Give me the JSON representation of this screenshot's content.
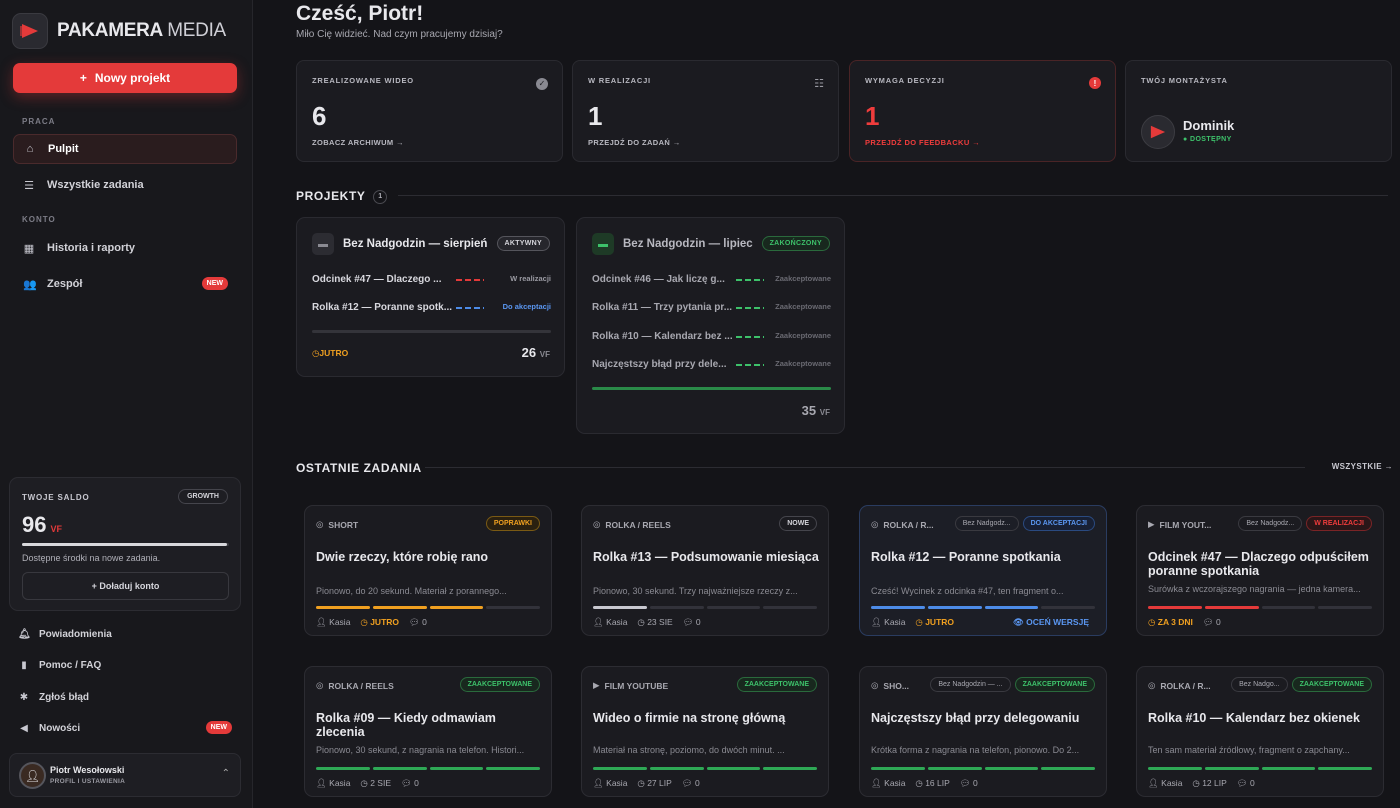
{
  "brand": {
    "name_a": "PAKAMERA",
    "name_b": "MEDIA"
  },
  "sidebar": {
    "new_project": "Nowy projekt",
    "section_work": "PRACA",
    "section_account": "KONTO",
    "items": [
      {
        "label": "Pulpit",
        "icon": "home-icon"
      },
      {
        "label": "Wszystkie zadania",
        "icon": "list-icon"
      },
      {
        "label": "Historia i raporty",
        "icon": "calendar-icon"
      },
      {
        "label": "Zespół",
        "icon": "users-icon",
        "badge": "NEW"
      }
    ],
    "balance": {
      "title": "TWOJE SALDO",
      "plan": "GROWTH",
      "value": "96",
      "unit": "VF",
      "desc": "Dostępne środki na nowe zadania.",
      "topup": "+ Doładuj konto",
      "fill": 0.99
    },
    "bottom": [
      {
        "label": "Powiadomienia",
        "icon": "bell-icon"
      },
      {
        "label": "Pomoc / FAQ",
        "icon": "book-icon"
      },
      {
        "label": "Zgłoś błąd",
        "icon": "bug-icon"
      },
      {
        "label": "Nowości",
        "icon": "megaphone-icon",
        "badge": "NEW"
      }
    ],
    "user": {
      "name": "Piotr Wesołowski",
      "sub": "PROFIL I USTAWIENIA"
    }
  },
  "header": {
    "title": "Cześć, Piotr!",
    "subtitle": "Miło Cię widzieć. Nad czym pracujemy dzisiaj?"
  },
  "stats": [
    {
      "title": "ZREALIZOWANE WIDEO",
      "value": "6",
      "link": "ZOBACZ ARCHIWUM →"
    },
    {
      "title": "W REALIZACJI",
      "value": "1",
      "link": "PRZEJDŹ DO ZADAŃ →"
    },
    {
      "title": "WYMAGA DECYZJI",
      "value": "1",
      "link": "PRZEJDŹ DO FEEDBACKU →",
      "alert": "!"
    },
    {
      "title": "TWÓJ MONTAŻYSTA",
      "name": "Dominik",
      "status": "DOSTĘPNY"
    }
  ],
  "projects_section": {
    "title": "PROJEKTY",
    "count": "1"
  },
  "projects": [
    {
      "title": "Bez Nadgodzin — sierpień",
      "badge": "AKTYWNY",
      "rows": [
        {
          "name": "Odcinek #47 — Dlaczego ...",
          "status": "W realizacji"
        },
        {
          "name": "Rolka #12 — Poranne spotk...",
          "status": "Do akceptacji"
        }
      ],
      "deadline": "JUTRO",
      "vf": "26",
      "unit": "VF"
    },
    {
      "title": "Bez Nadgodzin — lipiec",
      "badge": "ZAKOŃCZONY",
      "rows": [
        {
          "name": "Odcinek #46 — Jak liczę g...",
          "status": "Zaakceptowane"
        },
        {
          "name": "Rolka #11 — Trzy pytania pr...",
          "status": "Zaakceptowane"
        },
        {
          "name": "Rolka #10 — Kalendarz bez ...",
          "status": "Zaakceptowane"
        },
        {
          "name": "Najczęstszy błąd przy dele...",
          "status": "Zaakceptowane"
        }
      ],
      "vf": "35",
      "unit": "VF"
    }
  ],
  "tasks_section": {
    "title": "OSTATNIE ZADANIA",
    "all": "WSZYSTKIE →"
  },
  "tasks": [
    {
      "cat": "SHORT",
      "tag": "POPRAWKI",
      "title": "Dwie rzeczy, które robię rano",
      "desc": "Pionowo, do 20 sekund. Materiał z porannego...",
      "user": "Kasia",
      "date": "JUTRO",
      "comments": "0"
    },
    {
      "cat": "ROLKA / REELS",
      "tag": "NOWE",
      "title": "Rolka #13 — Podsumowanie miesiąca",
      "desc": "Pionowo, 30 sekund. Trzy najważniejsze rzeczy z...",
      "user": "Kasia",
      "date": "23 SIE",
      "comments": "0"
    },
    {
      "cat": "ROLKA / R...",
      "proj": "Bez Nadgodz...",
      "tag": "DO AKCEPTACJI",
      "title": "Rolka #12 — Poranne spotkania",
      "desc": "Cześć! Wycinek z odcinka #47, ten fragment o...",
      "user": "Kasia",
      "date": "JUTRO",
      "comments": "",
      "action": "OCEŃ WERSJĘ"
    },
    {
      "cat": "FILM YOUT...",
      "proj": "Bez Nadgodz...",
      "tag": "W REALIZACJI",
      "title": "Odcinek #47 — Dlaczego odpuściłem poranne spotkania",
      "desc": "Surówka z wczorajszego nagrania — jedna kamera...",
      "user": "",
      "date": "ZA 3 DNI",
      "comments": "0"
    },
    {
      "cat": "ROLKA / REELS",
      "tag": "ZAAKCEPTOWANE",
      "title": "Rolka #09 — Kiedy odmawiam zlecenia",
      "desc": "Pionowo, 30 sekund, z nagrania na telefon. Histori...",
      "user": "Kasia",
      "date": "2 SIE",
      "comments": "0"
    },
    {
      "cat": "FILM YOUTUBE",
      "tag": "ZAAKCEPTOWANE",
      "title": "Wideo o firmie na stronę główną",
      "desc": "Materiał na stronę, poziomo, do dwóch minut. ...",
      "user": "Kasia",
      "date": "27 LIP",
      "comments": "0"
    },
    {
      "cat": "SHO...",
      "proj": "Bez Nadgodzin — ...",
      "tag": "ZAAKCEPTOWANE",
      "title": "Najczęstszy błąd przy delegowaniu",
      "desc": "Krótka forma z nagrania na telefon, pionowo. Do 2...",
      "user": "Kasia",
      "date": "16 LIP",
      "comments": "0"
    },
    {
      "cat": "ROLKA / R...",
      "proj": "Bez Nadgo...",
      "tag": "ZAAKCEPTOWANE",
      "title": "Rolka #10 — Kalendarz bez okienek",
      "desc": "Ten sam materiał źródłowy, fragment o zapchany...",
      "user": "Kasia",
      "date": "12 LIP",
      "comments": "0"
    }
  ]
}
